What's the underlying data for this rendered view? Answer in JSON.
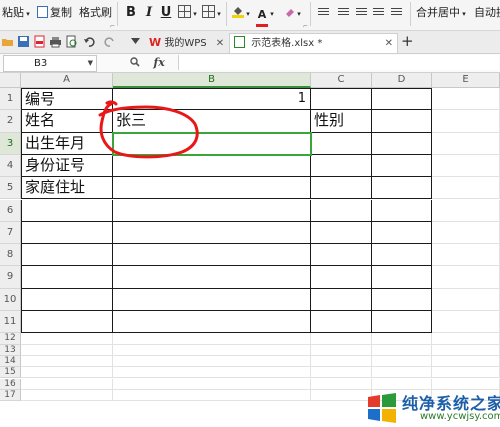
{
  "colors": {
    "accent_green": "#3aa63a",
    "pen_red": "#e81818",
    "brand_blue": "#1c5fa8"
  },
  "ribbon": {
    "paste_label": "粘贴",
    "copy_label": "复制",
    "format_painter_label": "格式刷",
    "bold_label": "B",
    "italic_label": "I",
    "underline_label": "U",
    "merge_center_label": "合并居中",
    "auto_wrap_label": "自动换"
  },
  "tabs": [
    {
      "label": "我的WPS",
      "icon": "wps-icon"
    },
    {
      "label": "示范表格.xlsx *",
      "icon": "spreadsheet-icon"
    }
  ],
  "formula_bar": {
    "name_box": "B3",
    "fx_label": "fx",
    "formula": ""
  },
  "sheet": {
    "columns": [
      "A",
      "B",
      "C",
      "D",
      "E"
    ],
    "rows": [
      "1",
      "2",
      "3",
      "4",
      "5",
      "6",
      "7",
      "8",
      "9",
      "10",
      "11",
      "12",
      "13",
      "14",
      "15",
      "16",
      "17"
    ],
    "selected_cell": "B3",
    "cells": {
      "A1": "编号",
      "B1": "1",
      "A2": "姓名",
      "B2": "张三",
      "C2": "性别",
      "A3": "出生年月",
      "A4": "身份证号",
      "A5": "家庭住址"
    }
  },
  "watermark": {
    "title": "纯净系统之家",
    "url": "www.ycwjsy.com"
  }
}
